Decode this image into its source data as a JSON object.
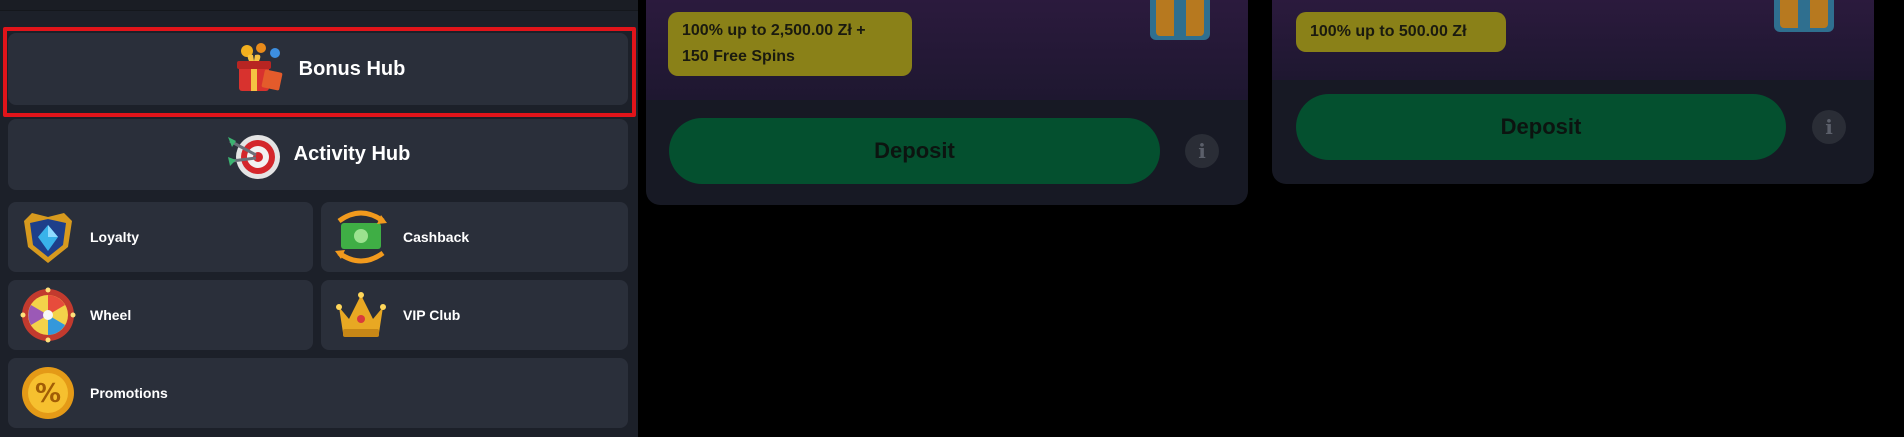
{
  "sidebar": {
    "bonus_hub": {
      "label": "Bonus Hub",
      "icon": "gift-box-icon"
    },
    "activity_hub": {
      "label": "Activity Hub",
      "icon": "dart-target-icon"
    },
    "items": [
      {
        "label": "Loyalty",
        "icon": "shield-gem-icon"
      },
      {
        "label": "Cashback",
        "icon": "cash-arrows-icon"
      },
      {
        "label": "Wheel",
        "icon": "fortune-wheel-icon"
      },
      {
        "label": "VIP Club",
        "icon": "crown-icon"
      },
      {
        "label": "Promotions",
        "icon": "percent-coin-icon"
      }
    ]
  },
  "offers": [
    {
      "badge_line1": "100% up to 2,500.00 Zł +",
      "badge_line2": "150 Free Spins",
      "deposit_label": "Deposit",
      "info_icon": "info-icon"
    },
    {
      "badge_line1": "100% up to 500.00 Zł",
      "badge_line2": "",
      "deposit_label": "Deposit",
      "info_icon": "info-icon"
    }
  ],
  "colors": {
    "highlight": "#e1141a",
    "deposit_bg": "#04502f",
    "badge_bg": "#8a8118",
    "tile_bg": "#2a2f3a"
  }
}
